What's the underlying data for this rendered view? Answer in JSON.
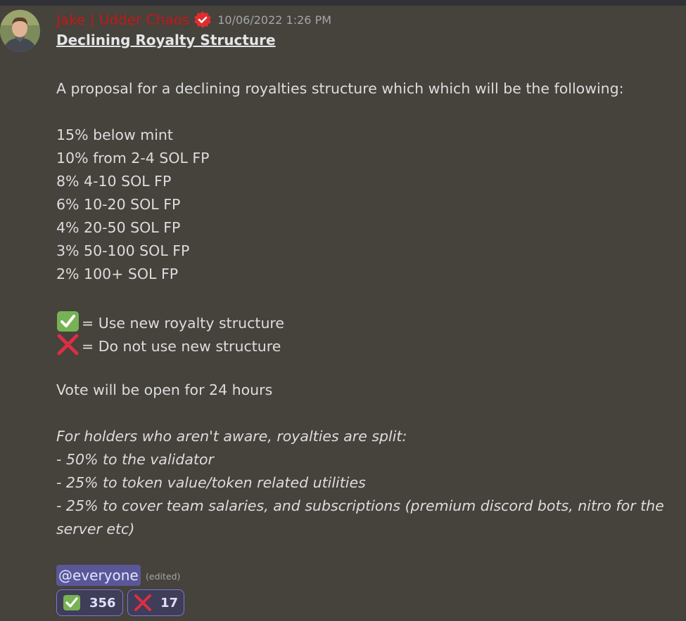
{
  "message": {
    "author": "Jake | Udder Chaos",
    "timestamp": "10/06/2022 1:26 PM",
    "title": "Declining Royalty Structure",
    "intro": "A proposal for a declining royalties structure which which will be the following:",
    "tiers": [
      "15% below mint",
      "10% from 2-4 SOL FP",
      "8% 4-10 SOL FP",
      "6% 10-20 SOL FP",
      "4% 20-50 SOL FP",
      "3% 50-100 SOL FP",
      "2% 100+ SOL FP"
    ],
    "options": {
      "yes": "= Use new royalty structure",
      "no": "= Do not use new structure"
    },
    "vote_duration": "Vote will be open for 24 hours",
    "split_lines": [
      "For holders who aren't aware, royalties are split:",
      "- 50% to the validator",
      "- 25% to token value/token related utilities",
      "- 25% to cover team salaries, and subscriptions (premium discord bots, nitro for the",
      "server etc)"
    ],
    "mention": "@everyone",
    "edited": "(edited)"
  },
  "reactions": {
    "check_count": "356",
    "cross_count": "17"
  },
  "icons": {
    "verified": "verified-badge-icon",
    "check": "check-mark-icon",
    "cross": "cross-mark-icon"
  },
  "colors": {
    "background": "#46423c",
    "username": "#c41818",
    "mention_bg": "#5a5799",
    "reaction_border": "#7a77d8",
    "check_green": "#77b255",
    "cross_red": "#dd2e44"
  }
}
